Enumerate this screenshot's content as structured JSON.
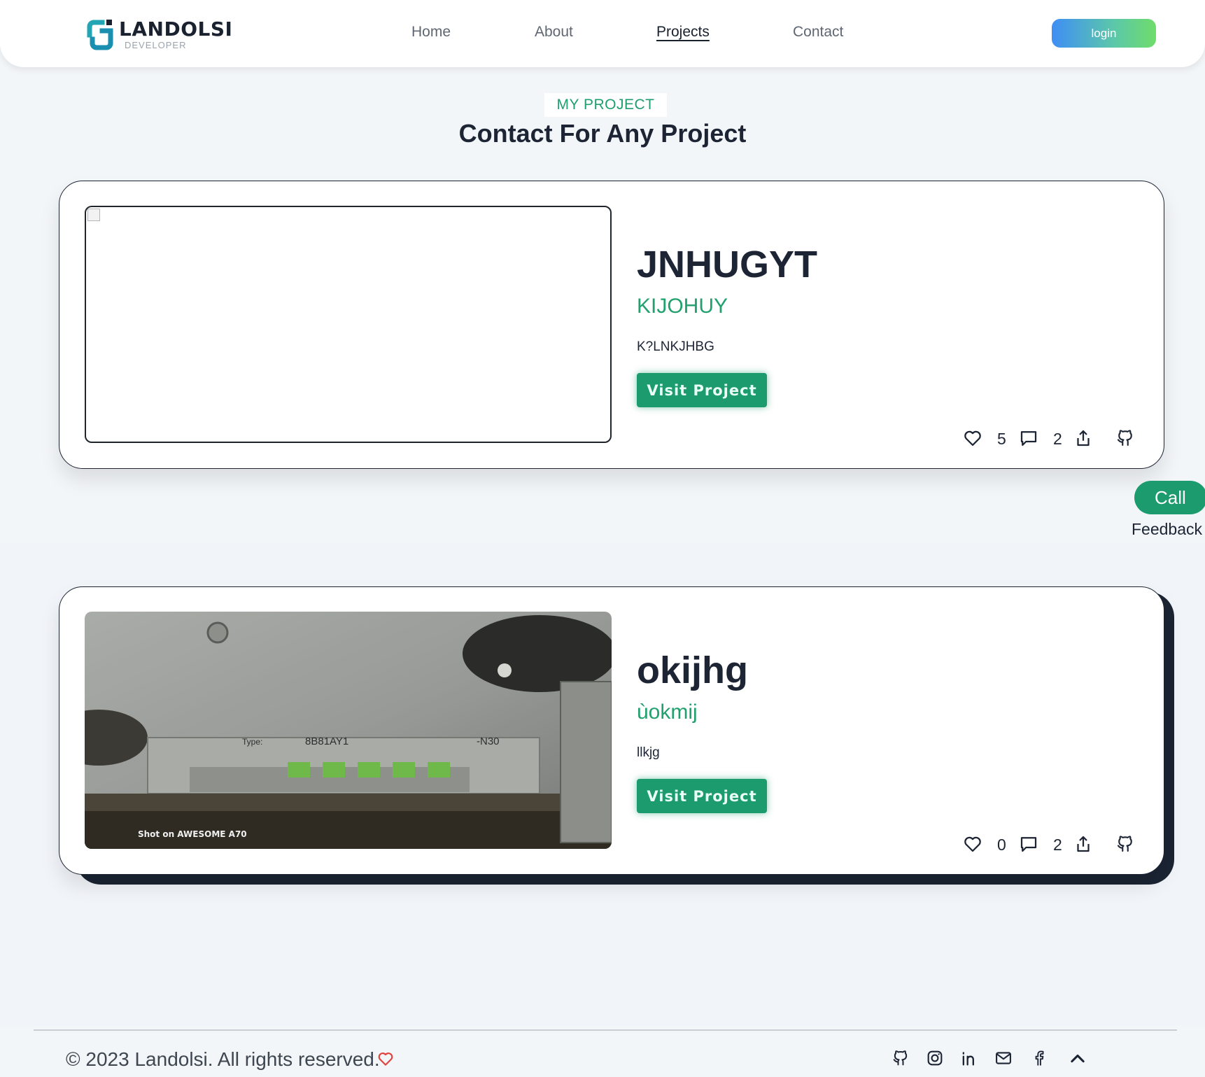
{
  "header": {
    "brand_title": "LANDOLSI",
    "brand_subtitle": "DEVELOPER",
    "nav": [
      {
        "label": "Home"
      },
      {
        "label": "About"
      },
      {
        "label": "Projects",
        "active": true
      },
      {
        "label": "Contact"
      }
    ],
    "login_label": "login"
  },
  "section": {
    "tag": "MY PROJECT",
    "title": "Contact For Any Project"
  },
  "projects": [
    {
      "title": "JNHUGYT",
      "subtitle": "KIJOHUY",
      "description": "K?LNKJHBG",
      "visit_label": "Visit Project",
      "likes": "5",
      "comments": "2",
      "image": "broken-image"
    },
    {
      "title": "okijhg",
      "subtitle": "ùokmij",
      "description": "llkjg",
      "visit_label": "Visit Project",
      "likes": "0",
      "comments": "2",
      "image": "photo-electrical-device",
      "image_caption": "Shot on AWESOME A70",
      "image_labels": [
        "Type:",
        "8B81AY1",
        "-N30"
      ]
    }
  ],
  "floating": {
    "call_label": "Call",
    "feedback_label": "Feedback"
  },
  "footer": {
    "copyright": "© 2023 Landolsi. All rights reserved.",
    "icons": [
      "github-icon",
      "instagram-icon",
      "linkedin-icon",
      "mail-icon",
      "facebook-icon",
      "chevron-up-icon"
    ]
  },
  "colors": {
    "accent_green": "#1b9b6e",
    "dark": "#1b2433",
    "login_gradient_start": "#3f8ef5",
    "login_gradient_end": "#6fdc6b",
    "heart_red": "#e0443c"
  }
}
